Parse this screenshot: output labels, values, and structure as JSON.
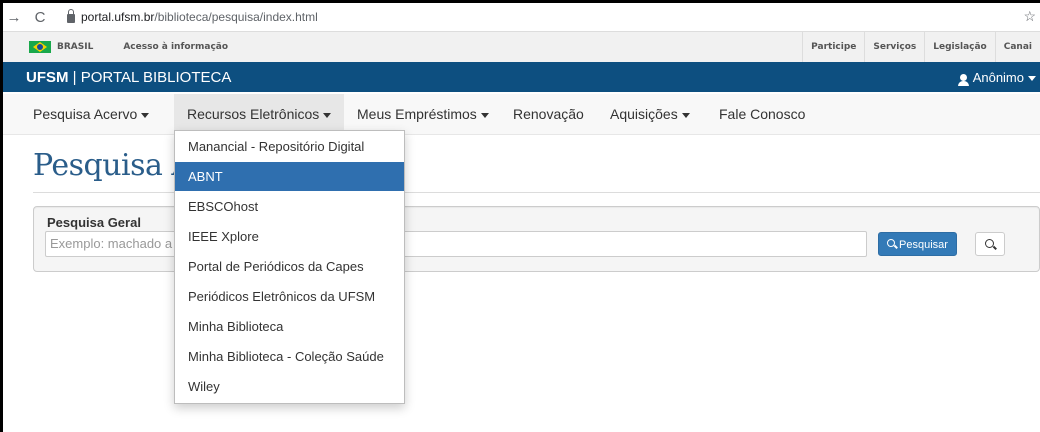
{
  "browser": {
    "back_glyph": "→",
    "reload_glyph": "C",
    "url_host": "portal.ufsm.br",
    "url_path": "/biblioteca/pesquisa/index.html",
    "star_glyph": "☆"
  },
  "govbar": {
    "brasil": "BRASIL",
    "acesso": "Acesso à informação",
    "links": [
      "Participe",
      "Serviços",
      "Legislação",
      "Canai"
    ]
  },
  "header": {
    "brand_bold": "UFSM",
    "brand_rest": " | PORTAL BIBLIOTECA",
    "user": "Anônimo"
  },
  "nav": {
    "items": [
      {
        "label": "Pesquisa Acervo",
        "has_caret": true
      },
      {
        "label": "Recursos Eletrônicos",
        "has_caret": true
      },
      {
        "label": "Meus Empréstimos",
        "has_caret": true
      },
      {
        "label": "Renovação",
        "has_caret": false
      },
      {
        "label": "Aquisições",
        "has_caret": true
      },
      {
        "label": "Fale Conosco",
        "has_caret": false
      }
    ]
  },
  "main": {
    "title": "Pesquisa Ac",
    "panel_label": "Pesquisa Geral",
    "search_placeholder": "Exemplo: machado a",
    "search_button": "Pesquisar"
  },
  "dropdown": {
    "items": [
      "Manancial - Repositório Digital",
      "ABNT",
      "EBSCOhost",
      "IEEE Xplore",
      "Portal de Periódicos da Capes",
      "Periódicos Eletrônicos da UFSM",
      "Minha Biblioteca",
      "Minha Biblioteca - Coleção Saúde",
      "Wiley"
    ],
    "active_index": 1
  },
  "colors": {
    "header_bg": "#0d4f80",
    "title": "#2a5d8a",
    "dropdown_active": "#2f6faf",
    "primary_button": "#337ab7"
  }
}
